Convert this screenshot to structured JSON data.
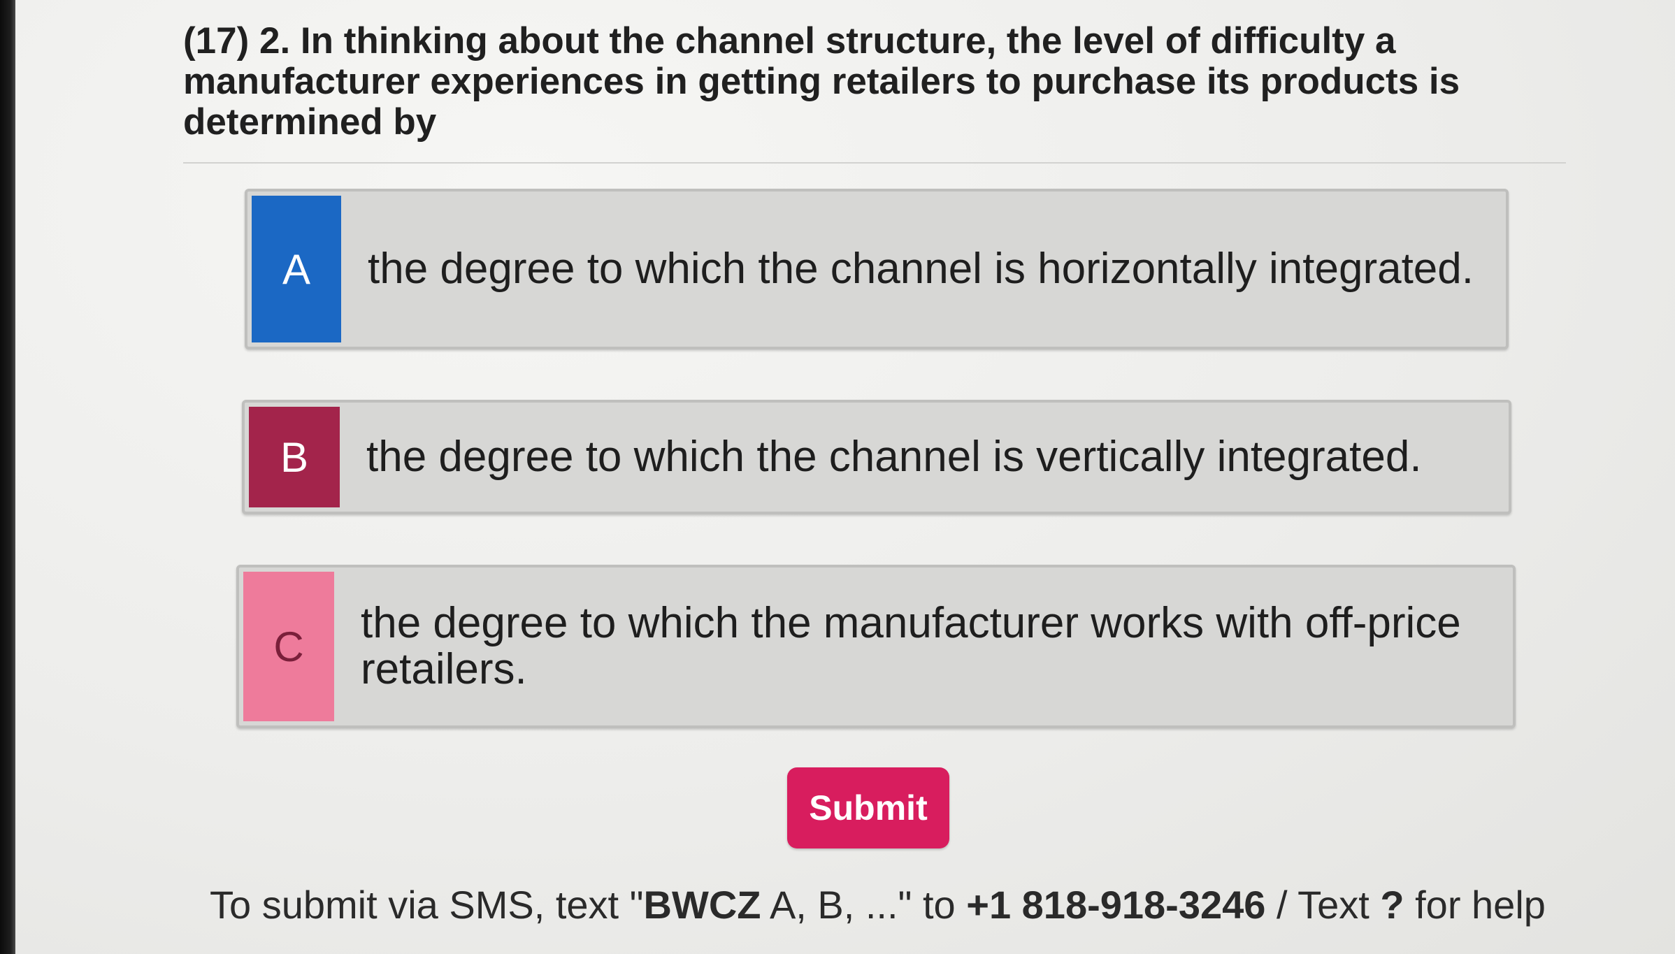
{
  "question": {
    "text": "(17) 2. In thinking about the channel structure, the level of difficulty a manufacturer experiences in getting retailers to purchase its products is determined by"
  },
  "options": [
    {
      "letter": "A",
      "text": "the degree to which the channel is horizontally integrated.",
      "color": "#1b68c4"
    },
    {
      "letter": "B",
      "text": "the degree to which the channel is vertically integrated.",
      "color": "#a3244b"
    },
    {
      "letter": "C",
      "text": "the degree to which the manufacturer works with off-price retailers.",
      "color": "#ee7b9b"
    }
  ],
  "submit": {
    "label": "Submit",
    "color": "#d81d5e"
  },
  "sms": {
    "prefix": "To submit via SMS, text \"",
    "code": "BWCZ",
    "mid": " A, B, ...\" to ",
    "number": "+1 818-918-3246",
    "sep": " / Text ",
    "help_char": "?",
    "suffix": " for help"
  }
}
